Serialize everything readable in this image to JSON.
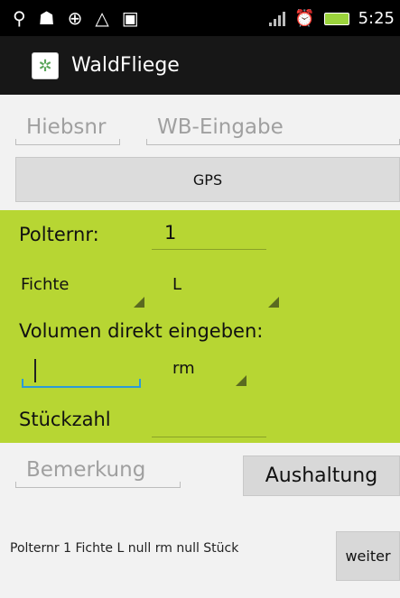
{
  "status_bar": {
    "time": "5:25",
    "icons": [
      "usb-icon",
      "debug-icon",
      "sync-icon",
      "warning-icon",
      "bag-icon",
      "signal-icon",
      "alarm-icon",
      "battery-icon"
    ]
  },
  "title_bar": {
    "title": "WaldFliege",
    "icon": "app-icon"
  },
  "inputs": {
    "hiebsnr_placeholder": "Hiebsnr",
    "wb_eingabe_placeholder": "WB-Eingabe"
  },
  "gps_button": {
    "label": "GPS"
  },
  "form": {
    "polternr_label": "Polternr:",
    "polternr_value": "1",
    "species_value": "Fichte",
    "class_value": "L",
    "volume_label": "Volumen direkt eingeben:",
    "volume_value": "",
    "unit_value": "rm",
    "stueckzahl_label": "Stückzahl",
    "stueckzahl_value": ""
  },
  "bottom": {
    "bemerkung_placeholder": "Bemerkung",
    "aushaltung_label": "Aushaltung",
    "weiter_label": "weiter",
    "summary_text": "Polternr  1 Fichte L null rm null Stück"
  },
  "colors": {
    "form_background": "#b7d633",
    "active_underline": "#2c9ad8",
    "title_bar": "#171717"
  }
}
